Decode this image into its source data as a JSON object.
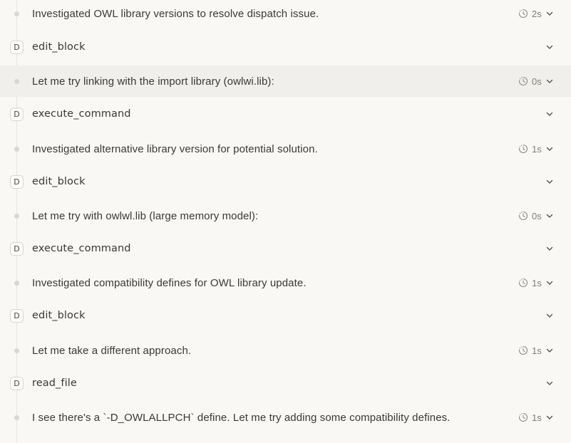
{
  "rows": [
    {
      "kind": "thought",
      "text": "Investigated OWL library versions to resolve dispatch issue.",
      "duration": "2s"
    },
    {
      "kind": "tool",
      "badge": "D",
      "text": "edit_block"
    },
    {
      "kind": "thought",
      "text": "Let me try linking with the import library (owlwi.lib):",
      "duration": "0s"
    },
    {
      "kind": "tool",
      "badge": "D",
      "text": "execute_command"
    },
    {
      "kind": "thought",
      "text": "Investigated alternative library version for potential solution.",
      "duration": "1s"
    },
    {
      "kind": "tool",
      "badge": "D",
      "text": "edit_block"
    },
    {
      "kind": "thought",
      "text": "Let me try with owlwl.lib (large memory model):",
      "duration": "0s"
    },
    {
      "kind": "tool",
      "badge": "D",
      "text": "execute_command"
    },
    {
      "kind": "thought",
      "text": "Investigated compatibility defines for OWL library update.",
      "duration": "1s"
    },
    {
      "kind": "tool",
      "badge": "D",
      "text": "edit_block"
    },
    {
      "kind": "thought",
      "text": "Let me take a different approach.",
      "duration": "1s"
    },
    {
      "kind": "tool",
      "badge": "D",
      "text": "read_file"
    },
    {
      "kind": "thought",
      "text": "I see there's a `-D_OWLALLPCH` define. Let me try adding some compatibility defines.",
      "duration": "1s"
    }
  ]
}
